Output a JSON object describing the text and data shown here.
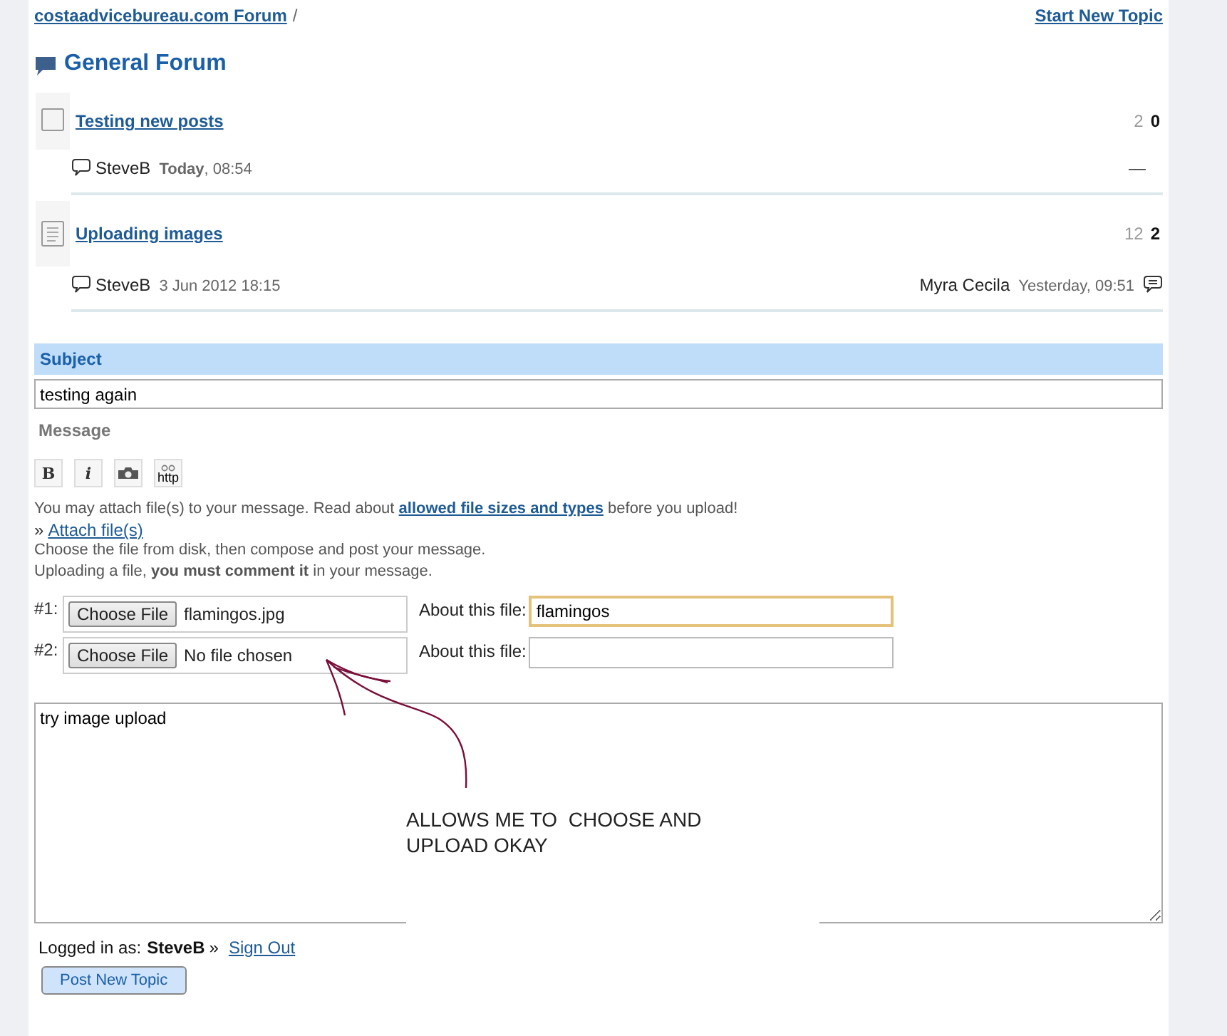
{
  "breadcrumb": {
    "forum_link": "costaadvicebureau.com Forum",
    "separator": "/"
  },
  "start_topic_link": "Start New Topic",
  "heading": "General Forum",
  "topics": [
    {
      "kind": "empty",
      "title": "Testing new posts",
      "replies": "2",
      "views": "0",
      "author": "SteveB",
      "date": "**Today**, 08:54",
      "last_placeholder": "—"
    },
    {
      "kind": "document",
      "title": "Uploading images",
      "replies": "12",
      "views": "2",
      "author": "SteveB",
      "date": "3 Jun 2012 18:15",
      "last_poster": "Myra Cecila",
      "last_date": "Yesterday, 09:51"
    }
  ],
  "form": {
    "subject_label": "Subject",
    "subject_value": "testing again",
    "message_label": "Message",
    "toolbar": [
      {
        "kind": "bold",
        "label": "B"
      },
      {
        "kind": "italic",
        "label": "i"
      },
      {
        "kind": "image"
      },
      {
        "kind": "link",
        "label": "http"
      }
    ],
    "attach_note": "You may attach file(s) to your message. Read about ",
    "attach_note_link": "allowed file sizes and types",
    "attach_note_end": " before you upload!",
    "attach_prefix": "»",
    "attach_link": "Attach file(s)",
    "hint_1": "Choose the file from disk, then compose and post your message.",
    "hint_2": "Uploading a file, **you must comment it** in your message.",
    "files": [
      {
        "number": "#1:",
        "button": "Choose File",
        "file_name": "flamingos.jpg",
        "about_label": "About this file:",
        "about_value": "flamingos",
        "focused": true
      },
      {
        "number": "#2:",
        "button": "Choose File",
        "file_name": "No file chosen",
        "about_label": "About this file:",
        "focused": false
      }
    ],
    "message_value": "try image upload",
    "logged_in_label": "Logged in as:",
    "user": "SteveB",
    "sign_out_prefix": "»",
    "sign_out": "Sign Out",
    "submit": "Post New Topic"
  },
  "annotation": {
    "lines": [
      "ALLOWS ME TO  CHOOSE AND",
      "UPLOAD OKAY"
    ]
  }
}
